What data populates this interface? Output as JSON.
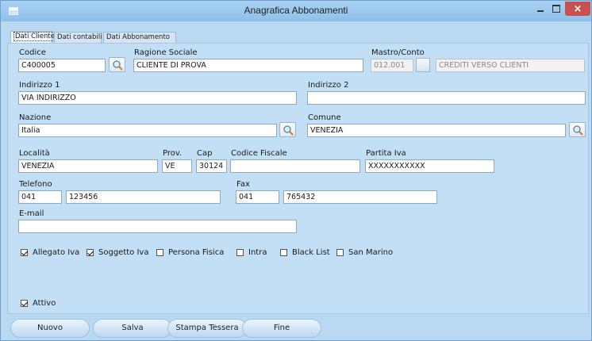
{
  "window": {
    "title": "Anagrafica Abbonamenti"
  },
  "tabs": [
    "Dati Cliente",
    "Dati contabili",
    "Dati Abbonamento"
  ],
  "fields": {
    "codice": {
      "label": "Codice",
      "value": "C400005"
    },
    "ragione_sociale": {
      "label": "Ragione Sociale",
      "value": "CLIENTE DI PROVA"
    },
    "mastro_conto": {
      "label": "Mastro/Conto",
      "value": "012.001",
      "description": "CREDITI VERSO CLIENTI"
    },
    "indirizzo1": {
      "label": "Indirizzo 1",
      "value": "VIA INDIRIZZO"
    },
    "indirizzo2": {
      "label": "Indirizzo 2",
      "value": ""
    },
    "nazione": {
      "label": "Nazione",
      "value": "Italia"
    },
    "comune": {
      "label": "Comune",
      "value": "VENEZIA"
    },
    "localita": {
      "label": "Località",
      "value": "VENEZIA"
    },
    "prov": {
      "label": "Prov.",
      "value": "VE"
    },
    "cap": {
      "label": "Cap",
      "value": "30124"
    },
    "codice_fiscale": {
      "label": "Codice Fiscale",
      "value": ""
    },
    "partita_iva": {
      "label": "Partita Iva",
      "value": "XXXXXXXXXXX"
    },
    "telefono": {
      "label": "Telefono",
      "prefix": "041",
      "number": "123456"
    },
    "fax": {
      "label": "Fax",
      "prefix": "041",
      "number": "765432"
    },
    "email": {
      "label": "E-mail",
      "value": ""
    }
  },
  "checkboxes": [
    {
      "label": "Allegato Iva",
      "checked": true
    },
    {
      "label": "Soggetto Iva",
      "checked": true
    },
    {
      "label": "Persona Fisica",
      "checked": false
    },
    {
      "label": "Intra",
      "checked": false
    },
    {
      "label": "Black List",
      "checked": false
    },
    {
      "label": "San Marino",
      "checked": false
    }
  ],
  "attivo": {
    "label": "Attivo",
    "checked": true
  },
  "buttons": {
    "nuovo": "Nuovo",
    "salva": "Salva",
    "stampa": "Stampa Tessera",
    "fine": "Fine"
  },
  "window_buttons": {
    "close": "×"
  },
  "icons": {
    "search": "magnifier-icon",
    "app": "window-icon"
  }
}
